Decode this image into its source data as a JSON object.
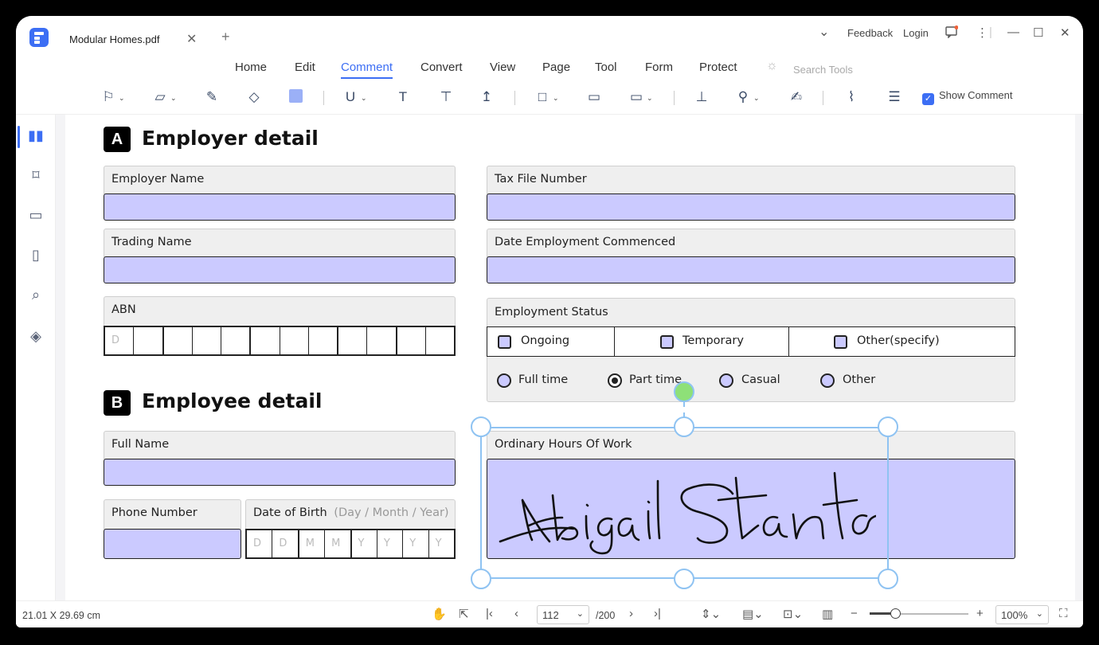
{
  "titlebar": {
    "tab_title": "Modular Homes.pdf",
    "tab_close": "✕",
    "new_tab": "+",
    "feedback": "Feedback",
    "login": "Login"
  },
  "menu": {
    "items": [
      "Home",
      "Edit",
      "Comment",
      "Convert",
      "View",
      "Page",
      "Tool",
      "Form",
      "Protect"
    ],
    "active": "Comment",
    "search_placeholder": "Search Tools"
  },
  "toolbar": {
    "show_comment": "Show Comment",
    "show_comment_checked": true,
    "highlight_color": "#9bb0f7"
  },
  "form": {
    "section_a": {
      "badge": "A",
      "title": "Employer detail"
    },
    "section_b": {
      "badge": "B",
      "title": "Employee detail"
    },
    "employer_name": "Employer Name",
    "trading_name": "Trading Name",
    "abn": "ABN",
    "abn_boxes": [
      "D",
      "",
      "",
      "",
      "",
      "",
      "",
      "",
      "",
      "",
      "",
      ""
    ],
    "tax_file_number": "Tax File Number",
    "date_commenced": "Date Employment Commenced",
    "employment_status": "Employment Status",
    "status_options": [
      "Ongoing",
      "Temporary",
      "Other(specify)"
    ],
    "hours_options": [
      "Full time",
      "Part time",
      "Casual",
      "Other"
    ],
    "hours_selected": "Part time",
    "full_name": "Full Name",
    "phone_number": "Phone Number",
    "dob_label": "Date of Birth",
    "dob_hint": "(Day / Month / Year)",
    "dob_boxes": [
      "D",
      "D",
      "M",
      "M",
      "Y",
      "Y",
      "Y",
      "Y"
    ],
    "ordinary_hours": "Ordinary Hours Of Work",
    "field_fill_color": "#cbcaff"
  },
  "statusbar": {
    "page_size": "21.01 X 29.69 cm",
    "current_page": "112",
    "total_pages": "/200",
    "zoom": "100%"
  }
}
